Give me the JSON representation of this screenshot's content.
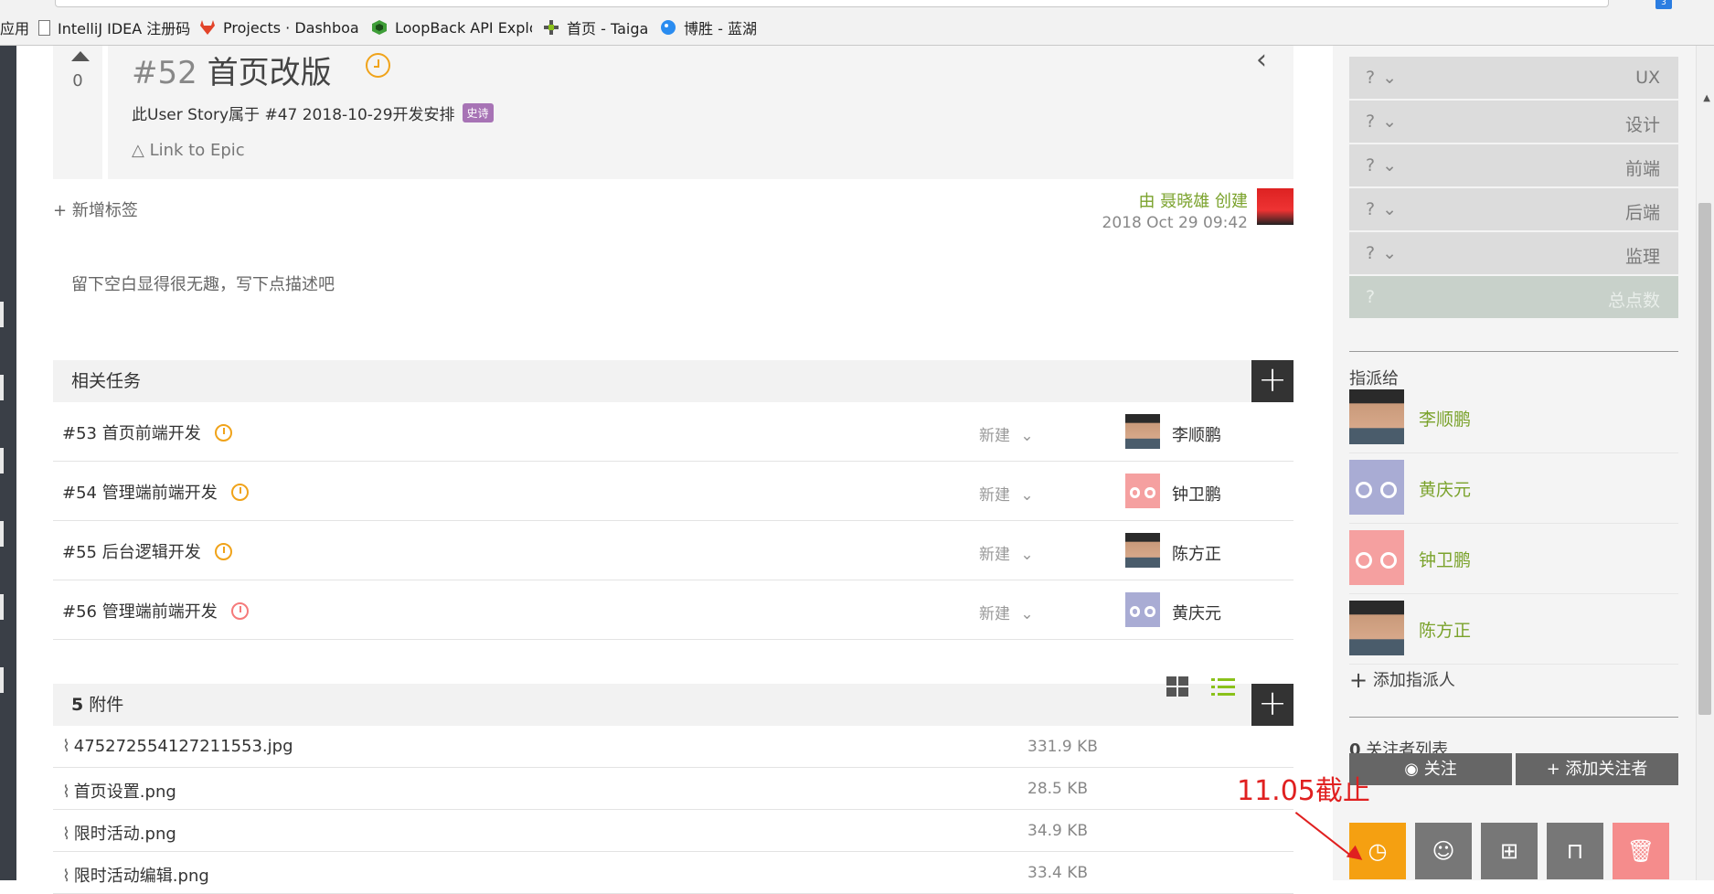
{
  "bookmarks": [
    {
      "label": "应用",
      "icon": "apps-icon"
    },
    {
      "label": "IntelliJ IDEA 注册码",
      "icon": "page-icon"
    },
    {
      "label": "Projects · Dashboard",
      "icon": "gitlab-icon"
    },
    {
      "label": "LoopBack API Explo",
      "icon": "loopback-icon"
    },
    {
      "label": "首页 - Taiga",
      "icon": "taiga-icon"
    },
    {
      "label": "博胜 - 蓝湖",
      "icon": "lanhu-icon"
    }
  ],
  "browser_badge": "3",
  "story": {
    "vote_count": "0",
    "ref": "#52",
    "title": "首页改版",
    "epic_text": "此User Story属于 #47 2018-10-29开发安排",
    "epic_badge": "史诗",
    "link_epic": "Link to Epic",
    "add_tag": "新增标签",
    "created_by": "由 聂晓雄 创建",
    "created_date": "2018 Oct 29 09:42",
    "description_placeholder": "留下空白显得很无趣，写下点描述吧"
  },
  "tasks": {
    "heading": "相关任务",
    "rows": [
      {
        "name": "#53 首页前端开发",
        "status": "新建",
        "assignee": "李顺鹏",
        "clock_color": "#f0a31a",
        "avatar": "photo"
      },
      {
        "name": "#54 管理端前端开发",
        "status": "新建",
        "assignee": "钟卫鹏",
        "clock_color": "#f0a31a",
        "avatar": "owl-pink"
      },
      {
        "name": "#55 后台逻辑开发",
        "status": "新建",
        "assignee": "陈方正",
        "clock_color": "#f0a31a",
        "avatar": "photo"
      },
      {
        "name": "#56 管理端前端开发",
        "status": "新建",
        "assignee": "黄庆元",
        "clock_color": "#f57a7a",
        "avatar": "owl-blue"
      }
    ]
  },
  "attachments": {
    "count": "5",
    "heading": "附件",
    "rows": [
      {
        "name": "475272554127211553.jpg",
        "size": "331.9 KB"
      },
      {
        "name": "首页设置.png",
        "size": "28.5 KB"
      },
      {
        "name": "限时活动.png",
        "size": "34.9 KB"
      },
      {
        "name": "限时活动编辑.png",
        "size": "33.4 KB"
      }
    ]
  },
  "sidebar": {
    "points": [
      {
        "value": "?",
        "label": "UX"
      },
      {
        "value": "?",
        "label": "设计"
      },
      {
        "value": "?",
        "label": "前端"
      },
      {
        "value": "?",
        "label": "后端"
      },
      {
        "value": "?",
        "label": "监理"
      },
      {
        "value": "?",
        "label": "总点数"
      }
    ],
    "assigned_heading": "指派给",
    "assignees": [
      {
        "name": "李顺鹏",
        "avatar": "photo"
      },
      {
        "name": "黄庆元",
        "avatar": "owl-blue"
      },
      {
        "name": "钟卫鹏",
        "avatar": "owl-pink"
      },
      {
        "name": "陈方正",
        "avatar": "photo"
      }
    ],
    "add_assignee": "添加指派人",
    "watchers_count": "0",
    "watchers_label": "关注者列表",
    "watch_button": "关注",
    "add_watcher_button": "+ 添加关注者"
  },
  "annotation": "11.05截止",
  "colors": {
    "accent_green": "#7aa22b",
    "clock_orange": "#f0a31a",
    "action_orange": "#f5a011",
    "delete_pink": "#f58c8c"
  }
}
